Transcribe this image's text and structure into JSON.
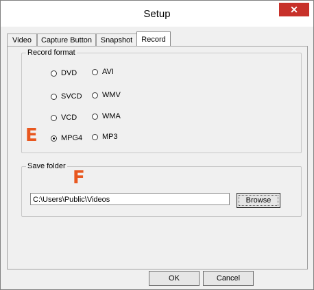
{
  "window": {
    "title": "Setup",
    "close_glyph": "✕"
  },
  "tabs": [
    {
      "label": "Video"
    },
    {
      "label": "Capture Button"
    },
    {
      "label": "Snapshot"
    },
    {
      "label": "Record",
      "active": true
    }
  ],
  "record_format": {
    "legend": "Record format",
    "options": [
      "DVD",
      "AVI",
      "SVCD",
      "WMV",
      "VCD",
      "WMA",
      "MPG4",
      "MP3"
    ],
    "selected": "MPG4"
  },
  "save_folder": {
    "legend": "Save folder",
    "path": "C:\\Users\\Public\\Videos",
    "browse_label": "Browse"
  },
  "markers": {
    "format_marker": "E",
    "folder_marker": "F",
    "color": "#e8571f"
  },
  "buttons": {
    "ok": "OK",
    "cancel": "Cancel"
  }
}
